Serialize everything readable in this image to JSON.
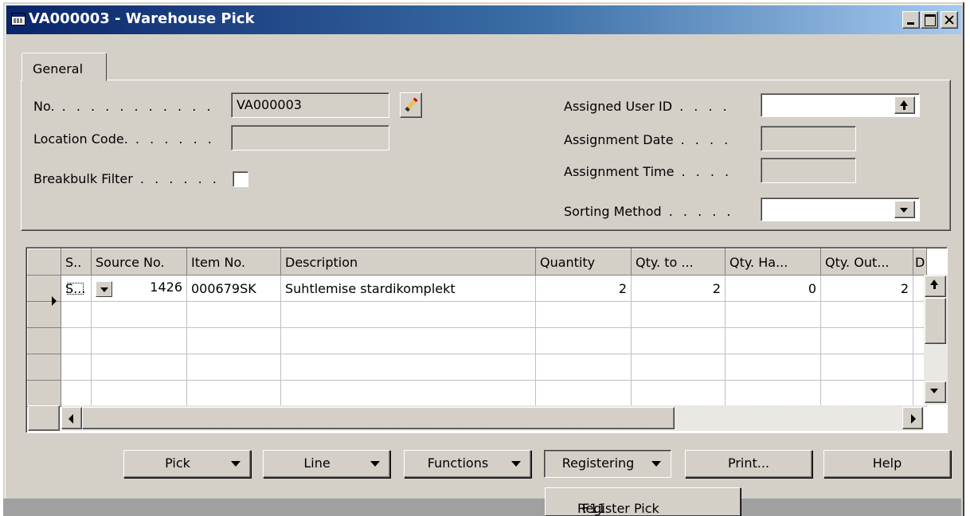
{
  "window": {
    "title": "VA000003 - Warehouse Pick"
  },
  "tabs": [
    {
      "label": "General"
    }
  ],
  "general": {
    "no_label": "No.",
    "no_value": "VA000003",
    "location_code_label": "Location Code.",
    "location_code_value": "",
    "breakbulk_filter_label": "Breakbulk Filter",
    "breakbulk_filter_checked": false,
    "assigned_user_id_label": "Assigned User ID",
    "assigned_user_id_value": "",
    "assignment_date_label": "Assignment Date",
    "assignment_date_value": "",
    "assignment_time_label": "Assignment Time",
    "assignment_time_value": "",
    "sorting_method_label": "Sorting Method",
    "sorting_method_value": ""
  },
  "lines": {
    "columns": [
      "S..",
      "Source No.",
      "Item No.",
      "Description",
      "Quantity",
      "Qty. to ...",
      "Qty. Ha...",
      "Qty. Out...",
      "D"
    ],
    "rows": [
      {
        "s": "S...",
        "source_no": "1426",
        "item_no": "000679SK",
        "description": "Suhtlemise stardikomplekt",
        "quantity": "2",
        "qty_to": "2",
        "qty_handled": "0",
        "qty_outstanding": "2"
      }
    ]
  },
  "buttons": {
    "pick": "Pick",
    "line": "Line",
    "functions": "Functions",
    "registering": "Registering",
    "print": "Print...",
    "help": "Help"
  },
  "popup_menu": {
    "item": "Register Pick",
    "shortcut": "F11"
  },
  "icons": [
    "window-icon",
    "minimize-icon",
    "maximize-icon",
    "close-icon",
    "pencil-icon",
    "lookup-arrow-icon",
    "dropdown-arrow-icon",
    "row-pointer-icon"
  ]
}
